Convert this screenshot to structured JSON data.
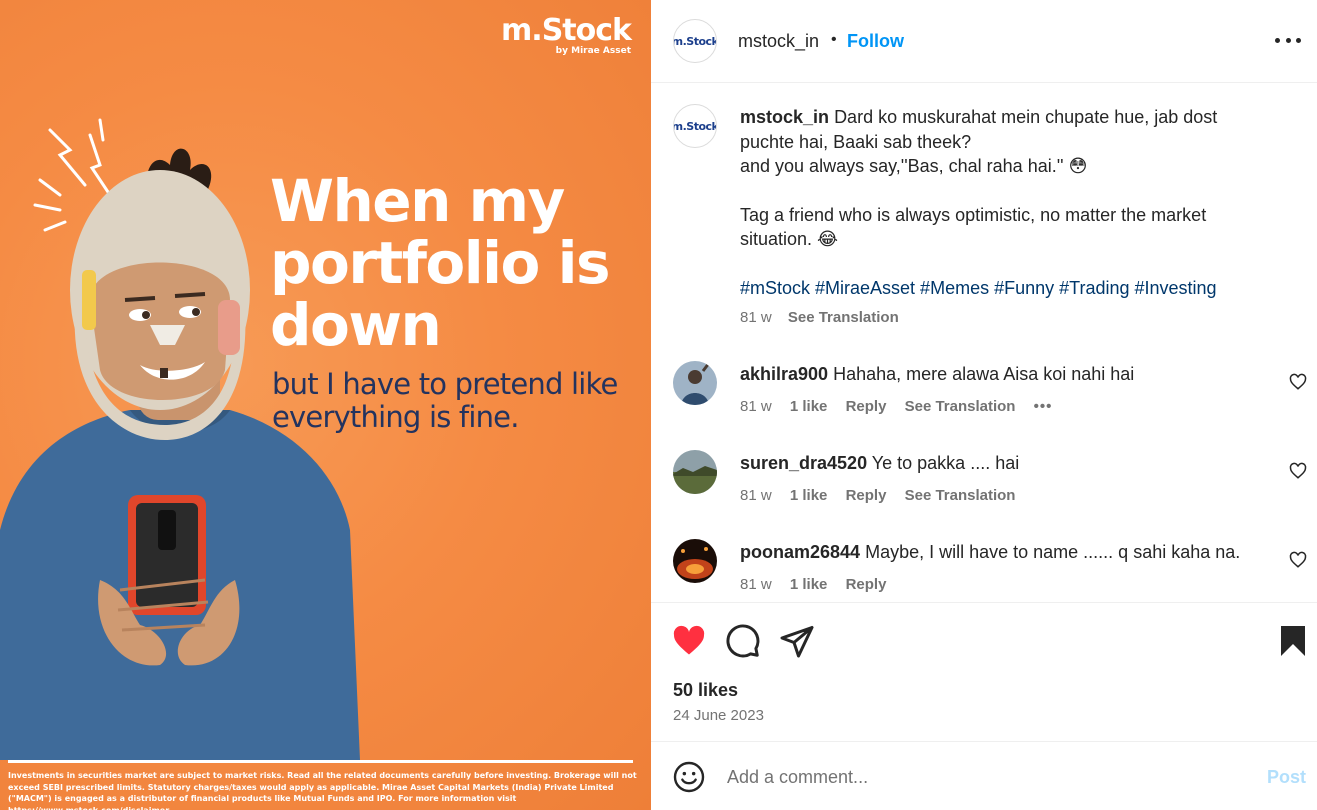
{
  "post_image": {
    "brand_name": "m.Stock",
    "brand_sub": "by Mirae Asset",
    "headline": "When my portfolio is down",
    "subline": "but I have to pretend like everything is fine.",
    "disclaimer": "Investments in securities market are subject to market risks. Read all the related documents carefully before investing. Brokerage will not exceed SEBI prescribed limits. Statutory charges/taxes would apply as applicable. Mirae Asset Capital Markets (India) Private Limited (\"MACM\") is engaged as a distributor of financial products like Mutual Funds and IPO. For more information visit https://www.mstock.com/disclaimer",
    "colors": {
      "background": "#f58b44",
      "headline": "#ffffff",
      "subline": "#23335f"
    }
  },
  "header": {
    "username": "mstock_in",
    "separator": "•",
    "follow_label": "Follow",
    "avatar_text": "m.Stock"
  },
  "caption": {
    "username": "mstock_in",
    "line1": "Dard ko muskurahat mein chupate hue, jab dost puchte hai, Baaki sab theek?",
    "line2": "and you always say,''Bas, chal raha hai.'' 😳",
    "line3": "Tag a friend who is always optimistic, no matter the market situation. 😂",
    "hashtags": "#mStock #MiraeAsset #Memes #Funny #Trading #Investing",
    "time": "81 w",
    "see_translation": "See Translation"
  },
  "comments": [
    {
      "username": "akhilra900",
      "text": "Hahaha, mere alawa Aisa koi nahi hai",
      "time": "81 w",
      "likes": "1 like",
      "reply": "Reply",
      "see_translation": "See Translation",
      "more": "•••"
    },
    {
      "username": "suren_dra4520",
      "text": "Ye to pakka .... hai",
      "time": "81 w",
      "likes": "1 like",
      "reply": "Reply",
      "see_translation": "See Translation"
    },
    {
      "username": "poonam26844",
      "text": "Maybe, I will have to name ...... q sahi kaha na.",
      "time": "81 w",
      "likes": "1 like",
      "reply": "Reply"
    }
  ],
  "actions": {
    "likes": "50 likes",
    "date": "24 June 2023",
    "icons": [
      "heart-icon",
      "comment-icon",
      "share-icon",
      "bookmark-icon"
    ],
    "liked_color": "#ff3040"
  },
  "comment_box": {
    "placeholder": "Add a comment...",
    "post_label": "Post"
  }
}
